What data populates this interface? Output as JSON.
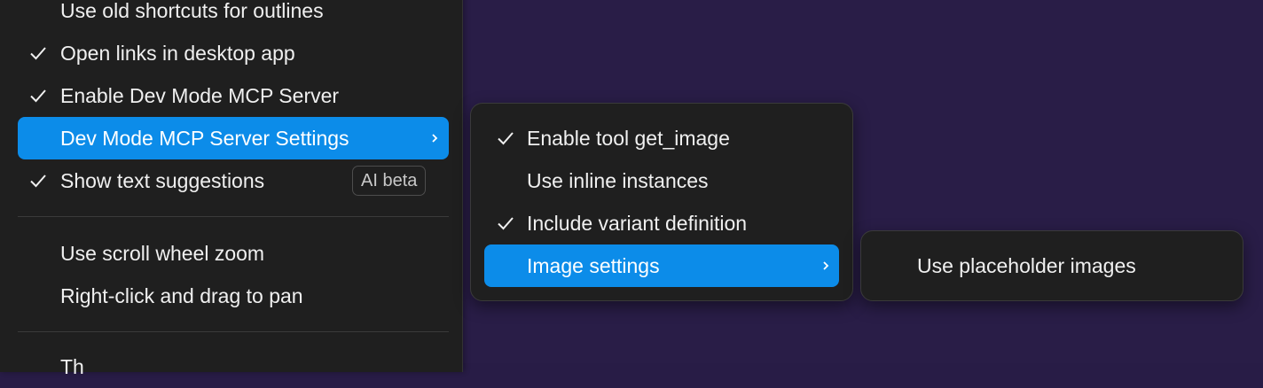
{
  "main_menu": {
    "items": [
      {
        "label": "Use old shortcuts for outlines",
        "checked": false
      },
      {
        "label": "Open links in desktop app",
        "checked": true
      },
      {
        "label": "Enable Dev Mode MCP Server",
        "checked": true
      },
      {
        "label": "Dev Mode MCP Server Settings",
        "checked": false,
        "highlighted": true,
        "has_submenu": true
      },
      {
        "label": "Show text suggestions",
        "checked": true,
        "badge": "AI beta"
      },
      {
        "label": "Use scroll wheel zoom",
        "checked": false
      },
      {
        "label": "Right-click and drag to pan",
        "checked": false
      },
      {
        "label": "Th",
        "checked": false
      }
    ]
  },
  "mcp_submenu": {
    "items": [
      {
        "label": "Enable tool get_image",
        "checked": true
      },
      {
        "label": "Use inline instances",
        "checked": false
      },
      {
        "label": "Include variant definition",
        "checked": true
      },
      {
        "label": "Image settings",
        "checked": false,
        "highlighted": true,
        "has_submenu": true
      }
    ]
  },
  "image_submenu": {
    "items": [
      {
        "label": "Use placeholder images",
        "checked": false
      }
    ]
  },
  "colors": {
    "canvas": "#291d47",
    "menu_bg": "#1f1f1f",
    "highlight": "#0c8ce9",
    "text": "#f0f0f0"
  },
  "icons": {
    "check": "check-icon",
    "chevron": "chevron-right-icon"
  }
}
